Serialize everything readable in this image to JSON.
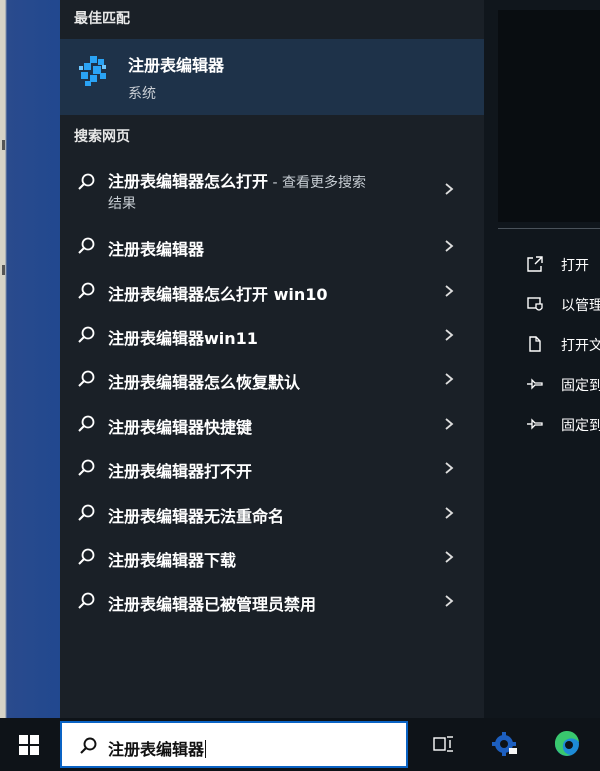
{
  "sections": {
    "best_match": "最佳匹配",
    "web_search": "搜索网页"
  },
  "best_match": {
    "name": "注册表编辑器",
    "type": "系统",
    "icon": "registry-editor-icon"
  },
  "web_results": [
    {
      "query": "注册表编辑器怎么打开",
      "suffix": " - 查看更多搜索",
      "continuation": "结果"
    },
    {
      "query": "注册表编辑器"
    },
    {
      "query": "注册表编辑器怎么打开 win10"
    },
    {
      "query": "注册表编辑器win11"
    },
    {
      "query": "注册表编辑器怎么恢复默认"
    },
    {
      "query": "注册表编辑器快捷键"
    },
    {
      "query": "注册表编辑器打不开"
    },
    {
      "query": "注册表编辑器无法重命名"
    },
    {
      "query": "注册表编辑器下载"
    },
    {
      "query": "注册表编辑器已被管理员禁用"
    }
  ],
  "preview_actions": [
    {
      "label": "打开",
      "icon": "open-icon"
    },
    {
      "label": "以管理",
      "icon": "run-as-admin-icon"
    },
    {
      "label": "打开文",
      "icon": "open-file-location-icon"
    },
    {
      "label": "固定到",
      "icon": "pin-icon"
    },
    {
      "label": "固定到",
      "icon": "pin-icon"
    }
  ],
  "taskbar": {
    "search_value": "注册表编辑器",
    "icons": [
      "windows-start-icon",
      "task-view-icon",
      "settings-icon",
      "edge-icon"
    ]
  },
  "colors": {
    "panel_bg": "#1a2027",
    "best_match_bg": "#1e3249",
    "search_border": "#0a63c4",
    "accent": "#2a9df4"
  }
}
